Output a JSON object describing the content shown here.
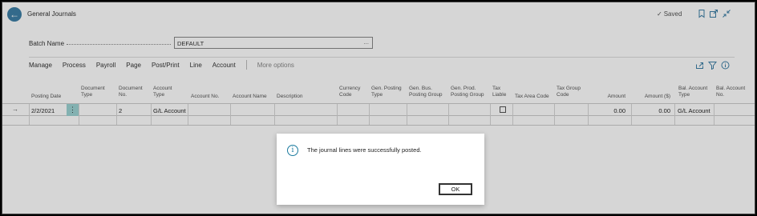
{
  "header": {
    "title": "General Journals",
    "saved_label": "Saved"
  },
  "batch": {
    "label": "Batch Name",
    "value": "DEFAULT",
    "more": "..."
  },
  "actions": {
    "items": [
      "Manage",
      "Process",
      "Payroll",
      "Page",
      "Post/Print",
      "Line",
      "Account"
    ],
    "more_options": "More options"
  },
  "grid": {
    "columns": [
      {
        "label": "Posting Date"
      },
      {
        "label": "Document Type"
      },
      {
        "label": "Document No."
      },
      {
        "label": "Account Type"
      },
      {
        "label": "Account No."
      },
      {
        "label": "Account Name"
      },
      {
        "label": "Description"
      },
      {
        "label": "Currency Code"
      },
      {
        "label": "Gen. Posting Type"
      },
      {
        "label": "Gen. Bus. Posting Group"
      },
      {
        "label": "Gen. Prod. Posting Group"
      },
      {
        "label": "Tax Liable"
      },
      {
        "label": "Tax Area Code"
      },
      {
        "label": "Tax Group Code"
      },
      {
        "label": "Amount"
      },
      {
        "label": "Amount ($)"
      },
      {
        "label": "Bal. Account Type"
      },
      {
        "label": "Bal. Account No."
      }
    ],
    "row": {
      "posting_date": "2/2/2021",
      "document_no": "2",
      "account_type": "G/L Account",
      "amount": "0.00",
      "amount_usd": "0.00",
      "bal_account_type": "G/L Account"
    }
  },
  "dialog": {
    "message": "The journal lines were successfully posted.",
    "ok_label": "OK"
  }
}
